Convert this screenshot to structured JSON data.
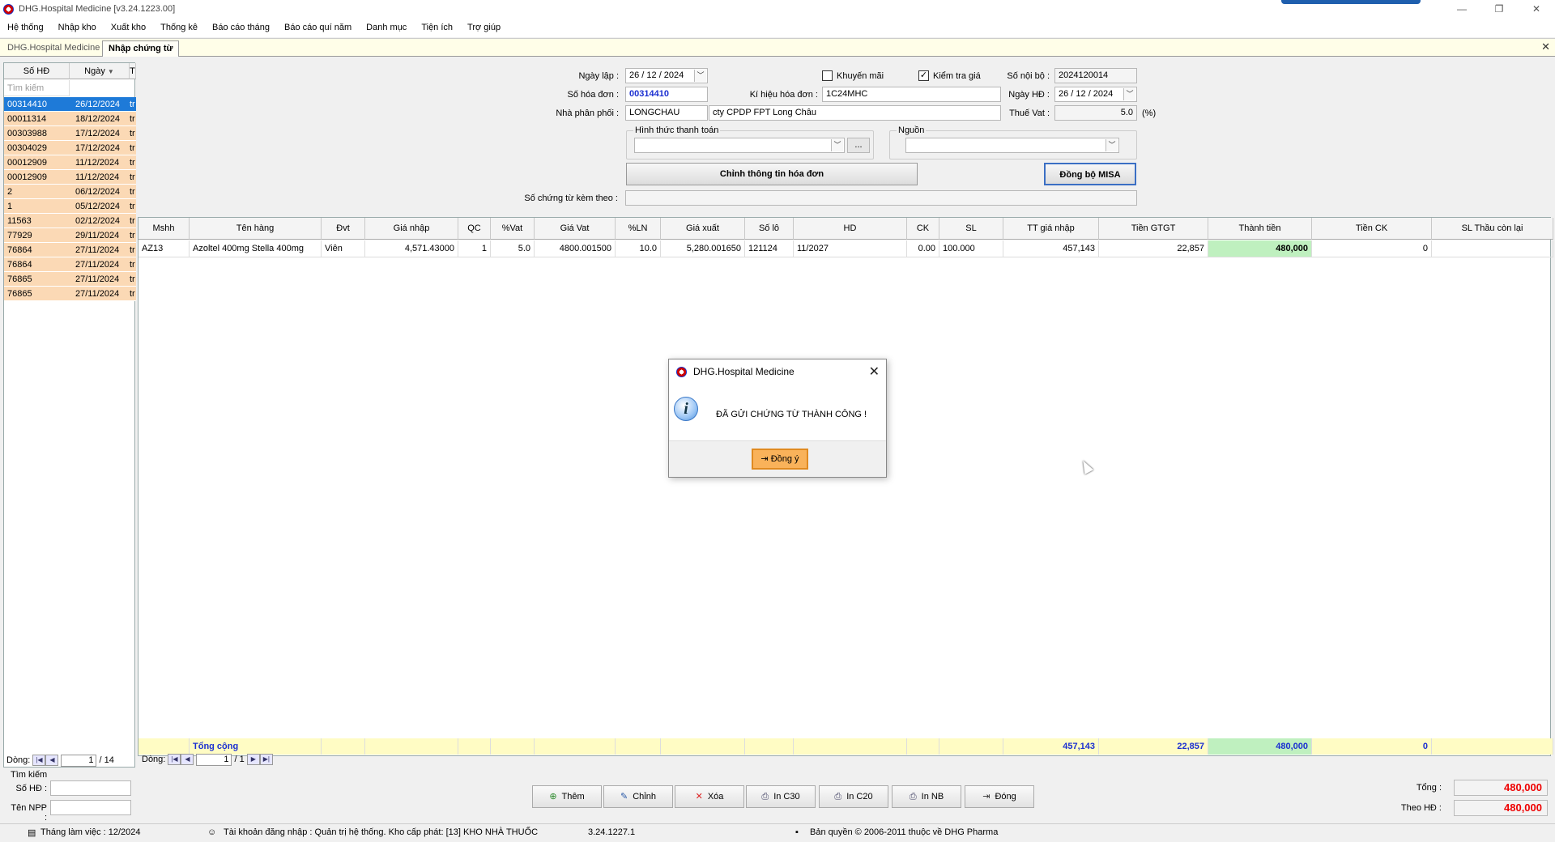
{
  "window": {
    "title": "DHG.Hospital Medicine [v3.24.1223.00]",
    "controls": [
      "—",
      "❐",
      "✕"
    ]
  },
  "menu": [
    "Hệ thống",
    "Nhập kho",
    "Xuất kho",
    "Thống kê",
    "Báo cáo tháng",
    "Báo cáo quí năm",
    "Danh mục",
    "Tiện ích",
    "Trợ giúp"
  ],
  "tabs": [
    {
      "label": "DHG.Hospital Medicine",
      "active": false
    },
    {
      "label": "Nhập chứng từ",
      "active": true
    }
  ],
  "tab_close": "✕",
  "left_panel": {
    "headers": [
      "Số HĐ",
      "Ngày",
      "T"
    ],
    "search_placeholder": "Tìm kiếm",
    "rows": [
      {
        "so_hd": "00314410",
        "ngay": "26/12/2024",
        "t": "tr",
        "selected": true
      },
      {
        "so_hd": "00011314",
        "ngay": "18/12/2024",
        "t": "tr"
      },
      {
        "so_hd": "00303988",
        "ngay": "17/12/2024",
        "t": "tr"
      },
      {
        "so_hd": "00304029",
        "ngay": "17/12/2024",
        "t": "tr"
      },
      {
        "so_hd": "00012909",
        "ngay": "11/12/2024",
        "t": "tr"
      },
      {
        "so_hd": "00012909",
        "ngay": "11/12/2024",
        "t": "tr"
      },
      {
        "so_hd": "2",
        "ngay": "06/12/2024",
        "t": "tr"
      },
      {
        "so_hd": "1",
        "ngay": "05/12/2024",
        "t": "tr"
      },
      {
        "so_hd": "11563",
        "ngay": "02/12/2024",
        "t": "tr"
      },
      {
        "so_hd": "77929",
        "ngay": "29/11/2024",
        "t": "tr"
      },
      {
        "so_hd": "76864",
        "ngay": "27/11/2024",
        "t": "tr"
      },
      {
        "so_hd": "76864",
        "ngay": "27/11/2024",
        "t": "tr"
      },
      {
        "so_hd": "76865",
        "ngay": "27/11/2024",
        "t": "tr"
      },
      {
        "so_hd": "76865",
        "ngay": "27/11/2024",
        "t": "tr"
      }
    ],
    "nav_label": "Dòng:",
    "nav_page": "1",
    "nav_total": "/ 14"
  },
  "form": {
    "ngay_lap_label": "Ngày lập :",
    "ngay_lap": "26 / 12 / 2024",
    "khuyen_mai_label": "Khuyến mãi",
    "khuyen_mai_checked": false,
    "kiem_tra_gia_label": "Kiểm tra giá",
    "kiem_tra_gia_checked": true,
    "so_noi_bo_label": "Số nội bộ :",
    "so_noi_bo": "2024120014",
    "so_hoa_don_label": "Số hóa đơn :",
    "so_hoa_don": "00314410",
    "ki_hieu_label": "Kí hiệu hóa đơn :",
    "ki_hieu": "1C24MHC",
    "ngay_hd_label": "Ngày HĐ :",
    "ngay_hd": "26 / 12 / 2024",
    "nha_phan_phoi_label": "Nhà phân phối :",
    "npp_code": "LONGCHAU",
    "npp_name": "cty CPDP FPT Long Châu",
    "thue_vat_label": "Thuế Vat :",
    "thue_vat": "5.0",
    "thue_vat_unit": "(%)",
    "hinh_thuc_label": "Hình thức thanh toán",
    "hinh_thuc_value": "",
    "browse_label": "...",
    "nguon_label": "Nguồn",
    "nguon_value": "",
    "chinh_thong_tin_button": "Chỉnh thông tin hóa đơn",
    "dong_bo_button": "Đồng bộ MISA",
    "so_chung_tu_label": "Số chứng từ kèm theo :",
    "so_chung_tu": ""
  },
  "grid": {
    "columns": [
      "Mshh",
      "Tên hàng",
      "Đvt",
      "Giá nhập",
      "QC",
      "%Vat",
      "Giá Vat",
      "%LN",
      "Giá xuất",
      "Số lô",
      "HD",
      "CK",
      "SL",
      "TT giá nhập",
      "Tiền GTGT",
      "Thành tiền",
      "Tiền CK",
      "SL Thầu còn lại"
    ],
    "rows": [
      [
        "AZ13",
        "Azoltel 400mg Stella 400mg",
        "Viên",
        "4,571.43000",
        "1",
        "5.0",
        "4800.001500",
        "10.0",
        "5,280.001650",
        "121124",
        "11/2027",
        "0.00",
        "100.000",
        "457,143",
        "22,857",
        "480,000",
        "0",
        ""
      ]
    ],
    "footer_label": "Tổng cộng",
    "footer_tt_gia_nhap": "457,143",
    "footer_tien_gtgt": "22,857",
    "footer_thanh_tien": "480,000",
    "footer_tien_ck": "0",
    "nav_label": "Dòng:",
    "nav_page": "1",
    "nav_total": "/ 1"
  },
  "search_box": {
    "title": "Tìm kiếm",
    "so_hd_label": "Số HĐ :",
    "ten_npp_label": "Tên NPP :"
  },
  "buttons": {
    "them": "Thêm",
    "chinh": "Chỉnh",
    "xoa": "Xóa",
    "in_c30": "In C30",
    "in_c20": "In C20",
    "in_nb": "In NB",
    "dong": "Đóng"
  },
  "totals": {
    "tong_label": "Tổng :",
    "tong": "480,000",
    "theo_hd_label": "Theo HĐ :",
    "theo_hd": "480,000"
  },
  "status": {
    "thang": "Tháng làm việc : 12/2024",
    "tai_khoan": "Tài khoản đăng nhập : Quản trị hệ thống. Kho cấp phát: [13] KHO NHÀ THUỐC",
    "version": "3.24.1227.1",
    "copyright": "Bản quyền © 2006-2011 thuộc về DHG Pharma"
  },
  "dialog": {
    "title": "DHG.Hospital Medicine",
    "message": "ĐÃ GỬI CHỨNG TỪ THÀNH CÔNG !",
    "ok_label": "Đồng ý",
    "close": "✕",
    "info_glyph": "i"
  },
  "colors": {
    "selected_row": "#1e7ad8",
    "row_bg": "#fbd9b5",
    "green_cell": "#bff0bf",
    "footer_bg": "#fffcc4",
    "total_red": "#e00000",
    "so_hoa_don_blue": "#1b2fd1",
    "ok_button": "#f9b25a"
  }
}
